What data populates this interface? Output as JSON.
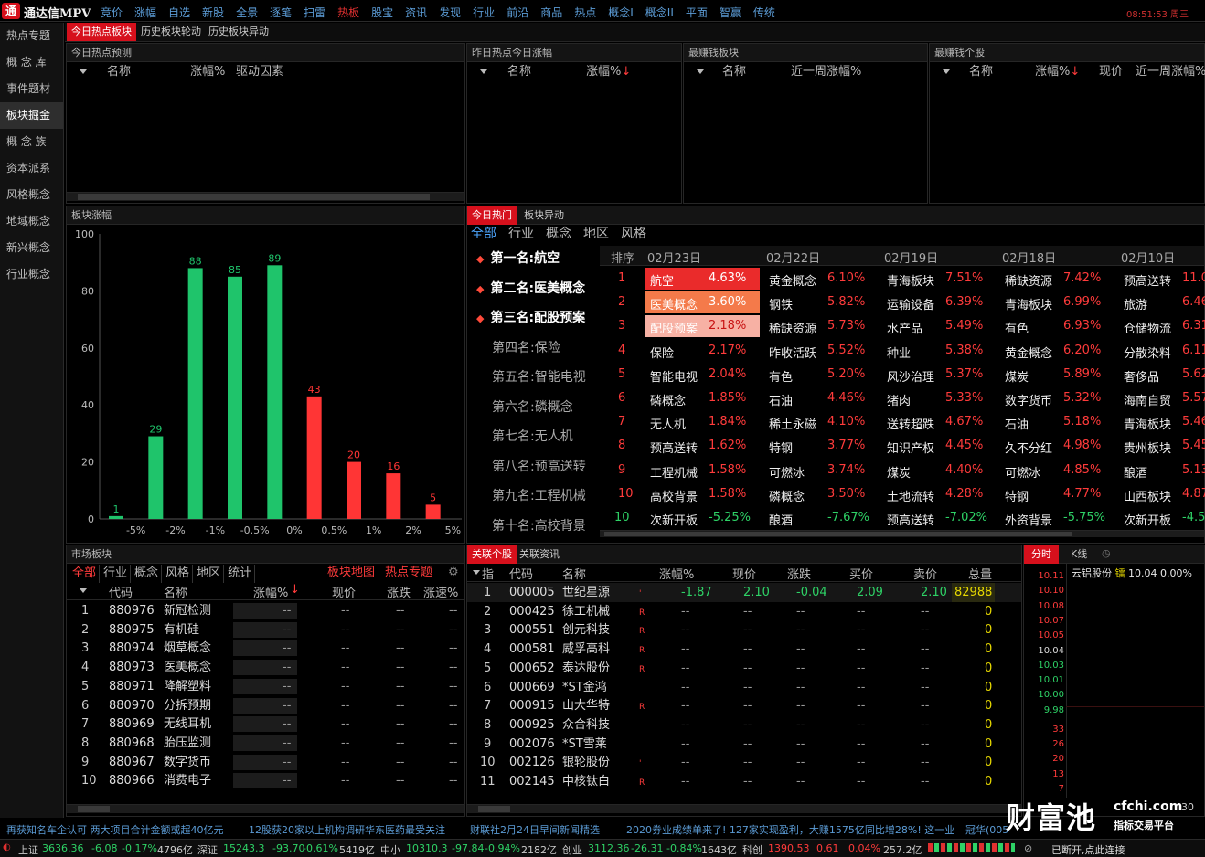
{
  "app": {
    "name": "通达信MPV",
    "logo": "通",
    "clock": "08:51:53 周三"
  },
  "menu": [
    "竞价",
    "涨幅",
    "自选",
    "新股",
    "全景",
    "逐笔",
    "扫雷",
    "热板",
    "股宝",
    "资讯",
    "发现",
    "行业",
    "前沿",
    "商品",
    "热点",
    "概念I",
    "概念II",
    "平面",
    "智赢",
    "传统"
  ],
  "menu_active": 7,
  "sidebar": [
    "热点专题",
    "概 念 库",
    "事件题材",
    "板块掘金",
    "概 念 族",
    "资本派系",
    "风格概念",
    "地域概念",
    "新兴概念",
    "行业概念"
  ],
  "sidebar_active": 3,
  "top_tabs": [
    "今日热点板块",
    "历史板块轮动",
    "历史板块异动"
  ],
  "p1": {
    "title": "今日热点预测",
    "cols": [
      "名称",
      "涨幅%",
      "驱动因素"
    ]
  },
  "p2": {
    "title": "昨日热点今日涨幅",
    "cols": [
      "名称",
      "涨幅%"
    ]
  },
  "p3": {
    "title": "最赚钱板块",
    "cols": [
      "名称",
      "近一周涨幅%"
    ]
  },
  "p4": {
    "title": "最赚钱个股",
    "cols": [
      "名称",
      "涨幅%",
      "现价",
      "近一周涨幅%"
    ]
  },
  "sort_arrow": "↓",
  "chart_panel_title": "板块涨幅",
  "chart_data": {
    "type": "bar",
    "title": "",
    "categories": [
      "",
      "-5%",
      "-2%",
      "-1%",
      "-0.5%",
      "0%",
      "0.5%",
      "1%",
      "2%",
      "5%"
    ],
    "values": [
      1,
      29,
      88,
      85,
      89,
      43,
      20,
      16,
      5
    ],
    "colors": [
      "#1fc46b",
      "#1fc46b",
      "#1fc46b",
      "#1fc46b",
      "#1fc46b",
      "#ff3535",
      "#ff3535",
      "#ff3535",
      "#ff3535"
    ],
    "yticks": [
      0,
      20,
      40,
      60,
      80,
      100
    ],
    "ylim": [
      0,
      100
    ],
    "grid": false
  },
  "hot": {
    "tabs": [
      "今日热门",
      "板块异动"
    ],
    "subtabs": [
      "全部",
      "行业",
      "概念",
      "地区",
      "风格"
    ],
    "ranks": [
      "第一名:航空",
      "第二名:医美概念",
      "第三名:配股预案",
      "第四名:保险",
      "第五名:智能电视",
      "第六名:磷概念",
      "第七名:无人机",
      "第八名:预高送转",
      "第九名:工程机械",
      "第十名:高校背景"
    ],
    "head": [
      "排序",
      "02月23日",
      "02月22日",
      "02月19日",
      "02月18日",
      "02月10日"
    ],
    "rows": [
      [
        "1",
        "航空",
        "4.63%",
        "黄金概念",
        "6.10%",
        "青海板块",
        "7.51%",
        "稀缺资源",
        "7.42%",
        "预高送转",
        "11.0"
      ],
      [
        "2",
        "医美概念",
        "3.60%",
        "钢铁",
        "5.82%",
        "运输设备",
        "6.39%",
        "青海板块",
        "6.99%",
        "旅游",
        "6.46"
      ],
      [
        "3",
        "配股预案",
        "2.18%",
        "稀缺资源",
        "5.73%",
        "水产品",
        "5.49%",
        "有色",
        "6.93%",
        "仓储物流",
        "6.31"
      ],
      [
        "4",
        "保险",
        "2.17%",
        "昨收活跃",
        "5.52%",
        "种业",
        "5.38%",
        "黄金概念",
        "6.20%",
        "分散染料",
        "6.11"
      ],
      [
        "5",
        "智能电视",
        "2.04%",
        "有色",
        "5.20%",
        "风沙治理",
        "5.37%",
        "煤炭",
        "5.89%",
        "奢侈品",
        "5.62"
      ],
      [
        "6",
        "磷概念",
        "1.85%",
        "石油",
        "4.46%",
        "猪肉",
        "5.33%",
        "数字货币",
        "5.32%",
        "海南自贸",
        "5.57"
      ],
      [
        "7",
        "无人机",
        "1.84%",
        "稀土永磁",
        "4.10%",
        "送转超跌",
        "4.67%",
        "石油",
        "5.18%",
        "青海板块",
        "5.46"
      ],
      [
        "8",
        "预高送转",
        "1.62%",
        "特钢",
        "3.77%",
        "知识产权",
        "4.45%",
        "久不分红",
        "4.98%",
        "贵州板块",
        "5.45"
      ],
      [
        "9",
        "工程机械",
        "1.58%",
        "可燃冰",
        "3.74%",
        "煤炭",
        "4.40%",
        "可燃冰",
        "4.85%",
        "酿酒",
        "5.13"
      ],
      [
        "10",
        "高校背景",
        "1.58%",
        "磷概念",
        "3.50%",
        "土地流转",
        "4.28%",
        "特钢",
        "4.77%",
        "山西板块",
        "4.87"
      ],
      [
        "10",
        "次新开板",
        "-5.25%",
        "酿酒",
        "-7.67%",
        "预高送转",
        "-7.02%",
        "外资背景",
        "-5.75%",
        "次新开板",
        "-4.5"
      ]
    ]
  },
  "market": {
    "title": "市场板块",
    "tabs": [
      "全部",
      "行业",
      "概念",
      "风格",
      "地区",
      "统计"
    ],
    "links": [
      "板块地图",
      "热点专题"
    ],
    "cols": [
      "代码",
      "名称",
      "涨幅%",
      "现价",
      "涨跌",
      "涨速%"
    ],
    "rows": [
      [
        "1",
        "880976",
        "新冠检测"
      ],
      [
        "2",
        "880975",
        "有机硅"
      ],
      [
        "3",
        "880974",
        "烟草概念"
      ],
      [
        "4",
        "880973",
        "医美概念"
      ],
      [
        "5",
        "880971",
        "降解塑料"
      ],
      [
        "6",
        "880970",
        "分拆预期"
      ],
      [
        "7",
        "880969",
        "无线耳机"
      ],
      [
        "8",
        "880968",
        "胎压监测"
      ],
      [
        "9",
        "880967",
        "数字货币"
      ],
      [
        "10",
        "880966",
        "消费电子"
      ]
    ],
    "dash": "--"
  },
  "stocks": {
    "tabs": [
      "关联个股",
      "关联资讯"
    ],
    "cols": [
      "指",
      "代码",
      "名称",
      "涨幅%",
      "现价",
      "涨跌",
      "买价",
      "卖价",
      "总量"
    ],
    "rows": [
      [
        "1",
        "000005",
        "世纪星源",
        "'",
        "-1.87",
        "2.10",
        "-0.04",
        "2.09",
        "2.10",
        "82988"
      ],
      [
        "2",
        "000425",
        "徐工机械",
        "R",
        "--",
        "--",
        "--",
        "--",
        "--",
        "0"
      ],
      [
        "3",
        "000551",
        "创元科技",
        "R",
        "--",
        "--",
        "--",
        "--",
        "--",
        "0"
      ],
      [
        "4",
        "000581",
        "威孚高科",
        "R",
        "--",
        "--",
        "--",
        "--",
        "--",
        "0"
      ],
      [
        "5",
        "000652",
        "泰达股份",
        "R",
        "--",
        "--",
        "--",
        "--",
        "--",
        "0"
      ],
      [
        "6",
        "000669",
        "*ST金鸿",
        "",
        "--",
        "--",
        "--",
        "--",
        "--",
        "0"
      ],
      [
        "7",
        "000915",
        "山大华特",
        "R",
        "--",
        "--",
        "--",
        "--",
        "--",
        "0"
      ],
      [
        "8",
        "000925",
        "众合科技",
        "",
        "--",
        "--",
        "--",
        "--",
        "--",
        "0"
      ],
      [
        "9",
        "002076",
        "*ST雪莱",
        "",
        "--",
        "--",
        "--",
        "--",
        "--",
        "0"
      ],
      [
        "10",
        "002126",
        "银轮股份",
        "'",
        "--",
        "--",
        "--",
        "--",
        "--",
        "0"
      ],
      [
        "11",
        "002145",
        "中核钛白",
        "R",
        "--",
        "--",
        "--",
        "--",
        "--",
        "0"
      ]
    ]
  },
  "minichart": {
    "tabs": [
      "分时",
      "K线"
    ],
    "stock": "云铝股份",
    "price": "10.04",
    "pct": "0.00%",
    "prices": [
      "10.11",
      "10.10",
      "10.08",
      "10.07",
      "10.05",
      "10.04",
      "10.03",
      "10.01",
      "10.00",
      "9.98"
    ],
    "vols": [
      "33",
      "26",
      "20",
      "13",
      "7"
    ],
    "time": "30"
  },
  "news": [
    "再获知名车企认可 两大项目合计金额或超40亿元",
    "12股获20家以上机构调研华东医药最受关注",
    "财联社2月24日早间新闻精选",
    "2020券业成绩单来了! 127家实现盈利，大赚1575亿同比增28%! 这一业",
    "冠华(005"
  ],
  "watermark": {
    "brand": "财富池",
    "url": "cfchi.com",
    "tag": "指标交易平台"
  },
  "status": {
    "sh": [
      "上证",
      "3636.36",
      "-6.08",
      "-0.17%",
      "4796亿"
    ],
    "sz": [
      "深证",
      "15243.3",
      "-93.70",
      "-0.61%",
      "5419亿"
    ],
    "zx": [
      "中小",
      "10310.3",
      "-97.84",
      "-0.94%",
      "2182亿"
    ],
    "cy": [
      "创业",
      "3112.36",
      "-26.31",
      "-0.84%",
      "1643亿"
    ],
    "kc": [
      "科创",
      "1390.53",
      "0.61",
      "0.04%",
      "257.2亿"
    ],
    "conn": "已断开,点此连接"
  }
}
